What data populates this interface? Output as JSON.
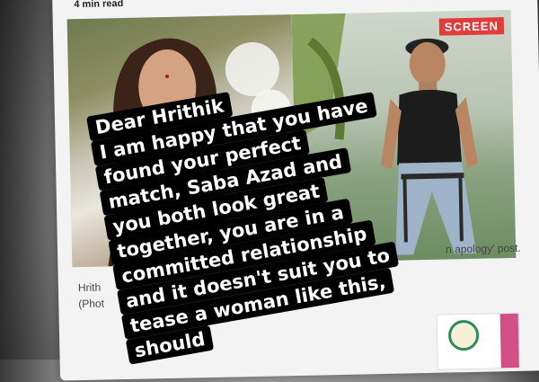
{
  "article": {
    "top_text": "4 min read",
    "badge": "SCREEN",
    "caption_left": [
      "Hrith",
      "(Phot"
    ],
    "caption_right": "n apology' post."
  },
  "story_text": {
    "lines": [
      "Dear Hrithik",
      "I am happy that you have",
      "found your perfect",
      "match, Saba Azad and",
      "you both look great",
      "together, you are in a",
      "committed relationship",
      "and it doesn't suit you to",
      "tease a woman like this,",
      "should"
    ]
  }
}
